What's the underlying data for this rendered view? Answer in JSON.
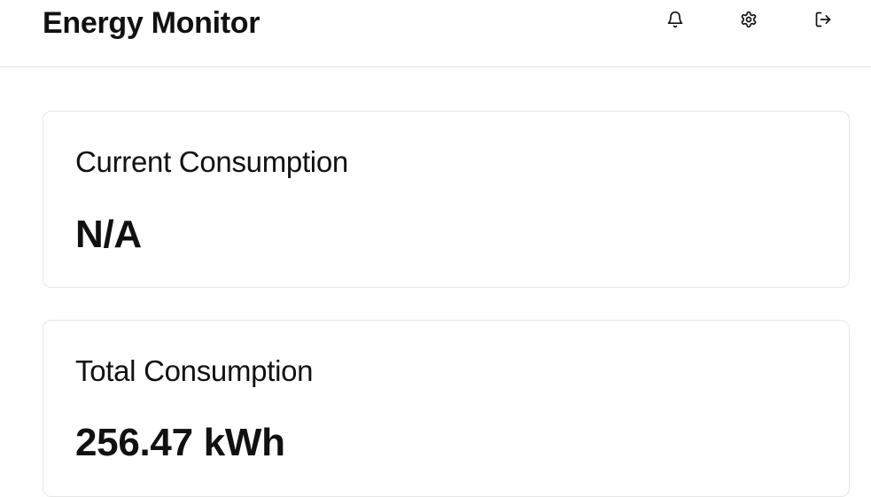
{
  "header": {
    "title": "Energy Monitor",
    "icons": {
      "notifications": "bell-icon",
      "settings": "gear-icon",
      "logout": "logout-icon"
    }
  },
  "cards": {
    "current": {
      "label": "Current Consumption",
      "value": "N/A"
    },
    "total": {
      "label": "Total Consumption",
      "value": "256.47 kWh"
    }
  }
}
